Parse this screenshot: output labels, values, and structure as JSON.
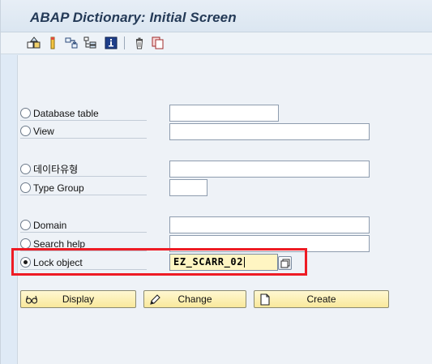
{
  "header": {
    "title": "ABAP Dictionary: Initial Screen"
  },
  "toolbar": {
    "buttons": [
      {
        "icon": "other-object-icon"
      },
      {
        "icon": "check-icon"
      },
      {
        "icon": "where-used-list-icon"
      },
      {
        "icon": "display-object-list-icon"
      },
      {
        "icon": "information-icon"
      },
      {
        "icon": "delete-icon"
      },
      {
        "icon": "copy-icon"
      }
    ]
  },
  "form": {
    "options": [
      {
        "label": "Database table",
        "value": "",
        "selected": false
      },
      {
        "label": "View",
        "value": "",
        "selected": false
      },
      {
        "label": "데이타유형",
        "value": "",
        "selected": false
      },
      {
        "label": "Type Group",
        "value": "",
        "selected": false
      },
      {
        "label": "Domain",
        "value": "",
        "selected": false
      },
      {
        "label": "Search help",
        "value": "",
        "selected": false
      },
      {
        "label": "Lock object",
        "value": "EZ_SCARR_02",
        "selected": true
      }
    ]
  },
  "actions": {
    "display_label": "Display",
    "change_label": "Change",
    "create_label": "Create"
  },
  "colors": {
    "highlight": "#ee1b24",
    "button_bg": "#f9e89b",
    "active_field_bg": "#fff5c2",
    "title_text": "#243a57"
  }
}
